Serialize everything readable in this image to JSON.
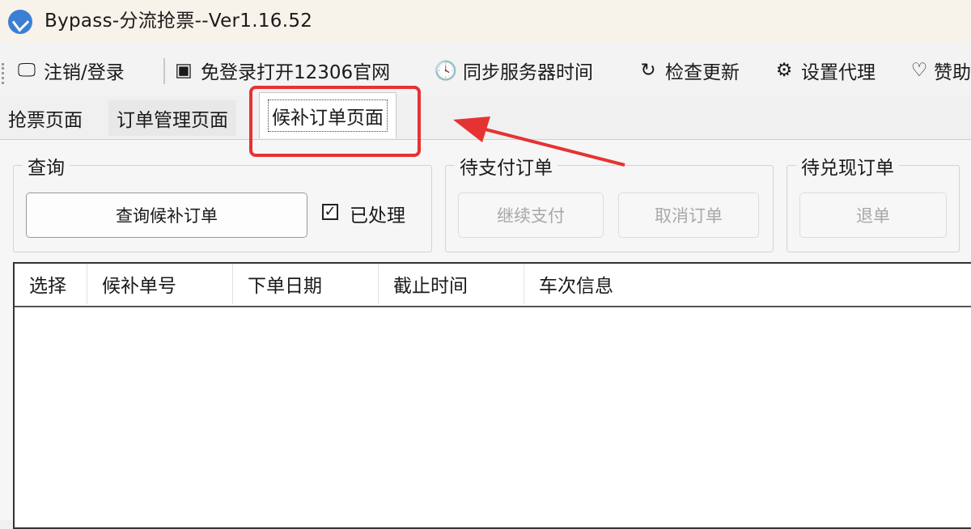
{
  "window": {
    "title": "Bypass-分流抢票--Ver1.16.52"
  },
  "menu": [
    {
      "icon": "monitor-icon",
      "glyph": "🖵",
      "label": "注销/登录"
    },
    {
      "icon": "browser-window-icon",
      "glyph": "▣",
      "label": "免登录打开12306官网"
    },
    {
      "icon": "clock-icon",
      "glyph": "🕓",
      "label": "同步服务器时间"
    },
    {
      "icon": "refresh-icon",
      "glyph": "↻",
      "label": "检查更新"
    },
    {
      "icon": "gear-icon",
      "glyph": "⚙",
      "label": "设置代理"
    },
    {
      "icon": "heart-icon",
      "glyph": "♡",
      "label": "赞助"
    }
  ],
  "tabs": [
    {
      "label": "抢票页面",
      "active": false
    },
    {
      "label": "订单管理页面",
      "active": false
    },
    {
      "label": "候补订单页面",
      "active": true
    }
  ],
  "query_group": {
    "title": "查询",
    "query_button": "查询候补订单",
    "processed_checkbox": {
      "label": "已处理",
      "checked": true
    }
  },
  "pending_payment_group": {
    "title": "待支付订单",
    "continue_pay_button": "继续支付",
    "cancel_order_button": "取消订单"
  },
  "pending_redeem_group": {
    "title": "待兑现订单",
    "refund_button": "退单"
  },
  "table": {
    "columns": [
      "选择",
      "候补单号",
      "下单日期",
      "截止时间",
      "车次信息"
    ],
    "rows": []
  },
  "colors": {
    "highlight": "#e53333",
    "accent": "#3b7fd4"
  }
}
